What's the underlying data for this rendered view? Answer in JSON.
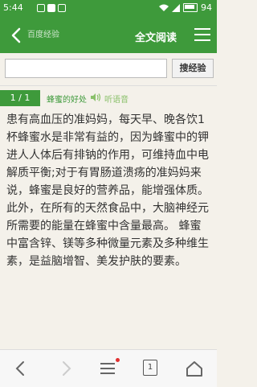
{
  "status": {
    "time": "5:44",
    "battery": "94"
  },
  "header": {
    "ghost_text": "百度经验",
    "fulltext_label": "全文阅读"
  },
  "search": {
    "value": "",
    "button_label": "搜经验"
  },
  "page": {
    "indicator": "1 / 1",
    "title": "蜂蜜的好处",
    "listen_label": "听语音"
  },
  "article": {
    "text": "患有高血压的准妈妈，每天早、晚各饮1杯蜂蜜水是非常有益的，因为蜂蜜中的钾进人人体后有排钠的作用，可维持血中电解质平衡;对于有胃肠道溃疡的准妈妈来说，蜂蜜是良好的营养品，能增强体质。此外，在所有的天然食品中，大脑神经元所需要的能量在蜂蜜中含量最高。 蜂蜜中富含锌、镁等多种微量元素及多种维生素，是益脑增智、美发护肤的要素。"
  },
  "bottom": {
    "page_count": "1"
  },
  "colors": {
    "brand_green": "#3e9a3b",
    "background": "#f4f1ea"
  }
}
